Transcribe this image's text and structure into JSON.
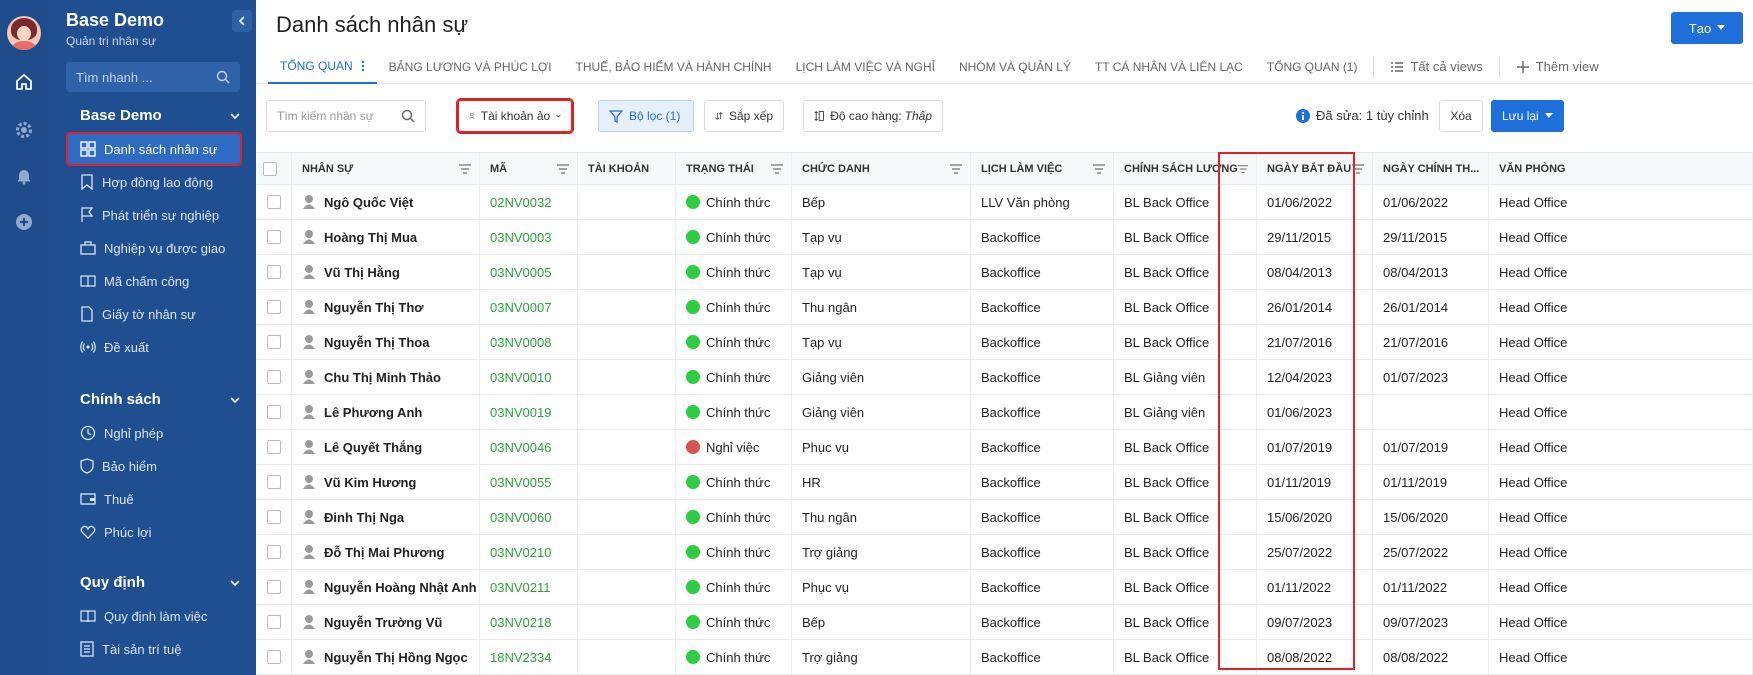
{
  "sidebar": {
    "app_title": "Base Demo",
    "app_subtitle": "Quản trị nhân sự",
    "search_placeholder": "Tìm nhanh ...",
    "groups": [
      {
        "title": "Base Demo",
        "items": [
          {
            "label": "Danh sách nhân sự",
            "icon": "grid-icon",
            "active": true
          },
          {
            "label": "Hợp đồng lao động",
            "icon": "bookmark-icon"
          },
          {
            "label": "Phát triển sự nghiệp",
            "icon": "flag-icon"
          },
          {
            "label": "Nghiệp vụ được giao",
            "icon": "briefcase-icon"
          },
          {
            "label": "Mã chấm công",
            "icon": "book-icon"
          },
          {
            "label": "Giấy tờ nhân sự",
            "icon": "document-icon"
          },
          {
            "label": "Đề xuất",
            "icon": "broadcast-icon"
          }
        ]
      },
      {
        "title": "Chính sách",
        "items": [
          {
            "label": "Nghỉ phép",
            "icon": "clock-icon"
          },
          {
            "label": "Bảo hiểm",
            "icon": "shield-icon"
          },
          {
            "label": "Thuế",
            "icon": "wallet-icon"
          },
          {
            "label": "Phúc lợi",
            "icon": "heart-icon"
          }
        ]
      },
      {
        "title": "Quy định",
        "items": [
          {
            "label": "Quy định làm việc",
            "icon": "book-icon"
          },
          {
            "label": "Tài sản trí tuệ",
            "icon": "list-icon"
          }
        ]
      }
    ]
  },
  "header": {
    "title": "Danh sách nhân sự",
    "create_label": "Tạo"
  },
  "tabs": [
    {
      "label": "TỔNG QUAN",
      "active": true
    },
    {
      "label": "BẢNG LƯƠNG VÀ PHÚC LỢI"
    },
    {
      "label": "THUẾ, BẢO HIỂM VÀ HÀNH CHÍNH"
    },
    {
      "label": "LỊCH LÀM VIỆC VÀ NGHỈ"
    },
    {
      "label": "NHÓM VÀ QUẢN LÝ"
    },
    {
      "label": "TT CÁ NHÂN VÀ LIÊN LẠC"
    },
    {
      "label": "TỔNG QUAN (1)"
    }
  ],
  "tab_actions": {
    "all_views": "Tất cả views",
    "add_view": "Thêm view"
  },
  "toolbar": {
    "search_placeholder": "Tìm kiếm nhân sự",
    "virtual_account": "Tài khoản ảo",
    "filter": "Bộ lọc (1)",
    "sort": "Sắp xếp",
    "row_height_label": "Độ cao hàng:",
    "row_height_value": "Thấp",
    "edited": "Đã sửa: 1 tùy chỉnh",
    "delete": "Xóa",
    "save": "Lưu lại"
  },
  "table": {
    "columns": [
      "NHÂN SỰ",
      "MÃ",
      "TÀI KHOẢN",
      "TRẠNG THÁI",
      "CHỨC DANH",
      "LỊCH LÀM VIỆC",
      "CHÍNH SÁCH LƯƠNG",
      "NGÀY BẮT ĐẦU",
      "NGÀY CHÍNH TH...",
      "VĂN PHÒNG"
    ],
    "rows": [
      {
        "name": "Ngô Quốc Việt",
        "code": "02NV0032",
        "account": "",
        "status": "Chính thức",
        "status_color": "#2ecc40",
        "title": "Bếp",
        "schedule": "LLV Văn phòng",
        "policy": "BL Back Office",
        "start": "01/06/2022",
        "official": "01/06/2022",
        "office": "Head Office"
      },
      {
        "name": "Hoàng Thị Mua",
        "code": "03NV0003",
        "account": "",
        "status": "Chính thức",
        "status_color": "#2ecc40",
        "title": "Tạp vụ",
        "schedule": "Backoffice",
        "policy": "BL Back Office",
        "start": "29/11/2015",
        "official": "29/11/2015",
        "office": "Head Office"
      },
      {
        "name": "Vũ Thị Hằng",
        "code": "03NV0005",
        "account": "",
        "status": "Chính thức",
        "status_color": "#2ecc40",
        "title": "Tạp vụ",
        "schedule": "Backoffice",
        "policy": "BL Back Office",
        "start": "08/04/2013",
        "official": "08/04/2013",
        "office": "Head Office"
      },
      {
        "name": "Nguyễn Thị Thơ",
        "code": "03NV0007",
        "account": "",
        "status": "Chính thức",
        "status_color": "#2ecc40",
        "title": "Thu ngân",
        "schedule": "Backoffice",
        "policy": "BL Back Office",
        "start": "26/01/2014",
        "official": "26/01/2014",
        "office": "Head Office"
      },
      {
        "name": "Nguyễn Thị Thoa",
        "code": "03NV0008",
        "account": "",
        "status": "Chính thức",
        "status_color": "#2ecc40",
        "title": "Tạp vụ",
        "schedule": "Backoffice",
        "policy": "BL Back Office",
        "start": "21/07/2016",
        "official": "21/07/2016",
        "office": "Head Office"
      },
      {
        "name": "Chu Thị Minh Thảo",
        "code": "03NV0010",
        "account": "",
        "status": "Chính thức",
        "status_color": "#2ecc40",
        "title": "Giảng viên",
        "schedule": "Backoffice",
        "policy": "BL Giảng viên",
        "start": "12/04/2023",
        "official": "01/07/2023",
        "office": "Head Office"
      },
      {
        "name": "Lê Phương Anh",
        "code": "03NV0019",
        "account": "",
        "status": "Chính thức",
        "status_color": "#2ecc40",
        "title": "Giảng viên",
        "schedule": "Backoffice",
        "policy": "BL Giảng viên",
        "start": "01/06/2023",
        "official": "",
        "office": "Head Office"
      },
      {
        "name": "Lê Quyết Thắng",
        "code": "03NV0046",
        "account": "",
        "status": "Nghỉ việc",
        "status_color": "#d9534f",
        "title": "Phục vụ",
        "schedule": "Backoffice",
        "policy": "BL Back Office",
        "start": "01/07/2019",
        "official": "01/07/2019",
        "office": "Head Office"
      },
      {
        "name": "Vũ Kim Hương",
        "code": "03NV0055",
        "account": "",
        "status": "Chính thức",
        "status_color": "#2ecc40",
        "title": "HR",
        "schedule": "Backoffice",
        "policy": "BL Back Office",
        "start": "01/11/2019",
        "official": "01/11/2019",
        "office": "Head Office"
      },
      {
        "name": "Đinh Thị Nga",
        "code": "03NV0060",
        "account": "",
        "status": "Chính thức",
        "status_color": "#2ecc40",
        "title": "Thu ngân",
        "schedule": "Backoffice",
        "policy": "BL Back Office",
        "start": "15/06/2020",
        "official": "15/06/2020",
        "office": "Head Office"
      },
      {
        "name": "Đỗ Thị Mai Phương",
        "code": "03NV0210",
        "account": "",
        "status": "Chính thức",
        "status_color": "#2ecc40",
        "title": "Trợ giảng",
        "schedule": "Backoffice",
        "policy": "BL Back Office",
        "start": "25/07/2022",
        "official": "25/07/2022",
        "office": "Head Office"
      },
      {
        "name": "Nguyễn Hoàng Nhật Anh",
        "code": "03NV0211",
        "account": "",
        "status": "Chính thức",
        "status_color": "#2ecc40",
        "title": "Phục vụ",
        "schedule": "Backoffice",
        "policy": "BL Back Office",
        "start": "01/11/2022",
        "official": "01/11/2022",
        "office": "Head Office"
      },
      {
        "name": "Nguyễn Trường Vũ",
        "code": "03NV0218",
        "account": "",
        "status": "Chính thức",
        "status_color": "#2ecc40",
        "title": "Bếp",
        "schedule": "Backoffice",
        "policy": "BL Back Office",
        "start": "09/07/2023",
        "official": "09/07/2023",
        "office": "Head Office"
      },
      {
        "name": "Nguyễn Thị Hồng Ngọc",
        "code": "18NV2334",
        "account": "",
        "status": "Chính thức",
        "status_color": "#2ecc40",
        "title": "Trợ giảng",
        "schedule": "Backoffice",
        "policy": "BL Back Office",
        "start": "08/08/2022",
        "official": "08/08/2022",
        "office": "Head Office"
      }
    ]
  },
  "colors": {
    "sidebar_bg": "#1f4f91",
    "accent": "#1e6fd9",
    "highlight": "#e0202a",
    "code_green": "#2aa33b"
  }
}
